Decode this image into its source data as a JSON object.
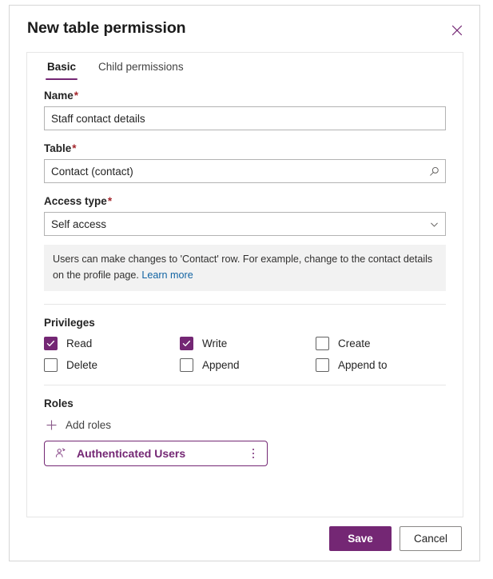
{
  "dialog": {
    "title": "New table permission",
    "close_label": "Close"
  },
  "tabs": [
    {
      "label": "Basic",
      "active": true
    },
    {
      "label": "Child permissions",
      "active": false
    }
  ],
  "form": {
    "name": {
      "label": "Name",
      "required_marker": "*",
      "value": "Staff contact details",
      "placeholder": ""
    },
    "table": {
      "label": "Table",
      "required_marker": "*",
      "value": "Contact (contact)",
      "placeholder": "",
      "icon": "search-icon"
    },
    "access_type": {
      "label": "Access type",
      "required_marker": "*",
      "value": "Self access",
      "icon": "chevron-down-icon",
      "options": [
        "Self access"
      ]
    },
    "info": {
      "text": "Users can make changes to 'Contact' row. For example, change to the contact details on the profile page. ",
      "link_label": "Learn more"
    }
  },
  "privileges": {
    "title": "Privileges",
    "items": [
      {
        "label": "Read",
        "checked": true
      },
      {
        "label": "Write",
        "checked": true
      },
      {
        "label": "Create",
        "checked": false
      },
      {
        "label": "Delete",
        "checked": false
      },
      {
        "label": "Append",
        "checked": false
      },
      {
        "label": "Append to",
        "checked": false
      }
    ]
  },
  "roles": {
    "title": "Roles",
    "add_label": "Add roles",
    "add_icon": "plus-icon",
    "chips": [
      {
        "label": "Authenticated Users",
        "icon": "person-role-icon",
        "menu_icon": "more-vertical-icon"
      }
    ]
  },
  "footer": {
    "save_label": "Save",
    "cancel_label": "Cancel"
  },
  "colors": {
    "accent": "#742774",
    "required": "#a4262c",
    "link": "#1264a3",
    "info_bg": "#f2f2f2",
    "border": "#d6d6d6"
  }
}
